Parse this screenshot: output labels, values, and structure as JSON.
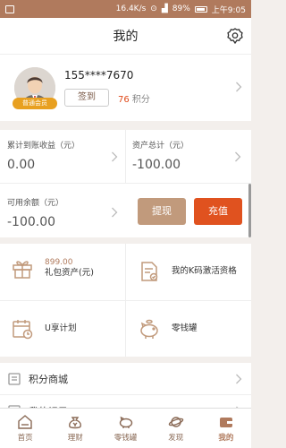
{
  "status_bar": {
    "speed": "16.4K/s",
    "battery": "89%",
    "time": "上午9:05"
  },
  "header": {
    "title": "我的"
  },
  "profile": {
    "phone": "155****7670",
    "member_badge": "普通会员",
    "signin_label": "签到",
    "points_value": "76",
    "points_unit": "积分"
  },
  "stats": {
    "cumulative_label": "累计到账收益（元）",
    "cumulative_value": "0.00",
    "assets_label": "资产总计（元）",
    "assets_value": "-100.00",
    "available_label": "可用余额（元）",
    "available_value": "-100.00",
    "withdraw_label": "提现",
    "recharge_label": "充值"
  },
  "grid": {
    "gift_amount": "899.00",
    "gift_label": "礼包资产(元)",
    "kcode_label": "我的K码激活资格",
    "uplan_label": "U享计划",
    "piggy_label": "零钱罐"
  },
  "list": [
    {
      "label": "积分商城"
    },
    {
      "label": "我的记录"
    }
  ],
  "tabs": [
    {
      "label": "首页"
    },
    {
      "label": "理财"
    },
    {
      "label": "零钱罐"
    },
    {
      "label": "发现"
    },
    {
      "label": "我的"
    }
  ],
  "colors": {
    "brand": "#b07a5d",
    "accent": "#e0521f",
    "badge": "#e8a020"
  }
}
